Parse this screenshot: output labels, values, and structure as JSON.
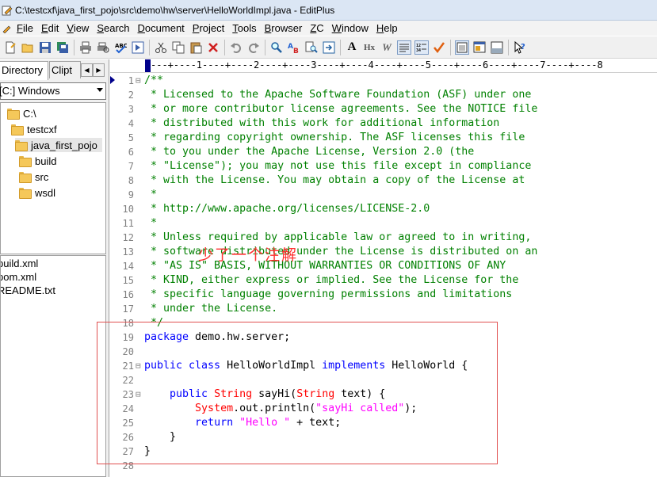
{
  "window": {
    "title": "C:\\testcxf\\java_first_pojo\\src\\demo\\hw\\server\\HelloWorldImpl.java - EditPlus"
  },
  "menu": [
    "File",
    "Edit",
    "View",
    "Search",
    "Document",
    "Project",
    "Tools",
    "Browser",
    "ZC",
    "Window",
    "Help"
  ],
  "toolbar": {
    "icons": [
      "new-icon",
      "open-icon",
      "save-icon",
      "save-all-icon",
      "print-icon",
      "print-preview-icon",
      "spellcheck-icon",
      "browser-preview-icon",
      "cut-icon",
      "copy-icon",
      "paste-icon",
      "delete-icon",
      "undo-icon",
      "redo-icon",
      "find-icon",
      "replace-icon",
      "find-in-files-icon",
      "goto-icon",
      "font-icon",
      "hex-icon",
      "word-wrap-icon",
      "ruler-icon",
      "line-number-icon",
      "check-icon",
      "window-icon",
      "full-screen-icon",
      "output-icon",
      "help-icon"
    ],
    "font_label": "A",
    "hex_label": "Hx",
    "wrap_label": "W"
  },
  "sidebar": {
    "tab_directory": "Directory",
    "tab_cliptext": "Clipt",
    "drive": "[C:] Windows",
    "tree": [
      "C:\\",
      "testcxf",
      "java_first_pojo",
      "build",
      "src",
      "wsdl"
    ],
    "files": [
      "build.xml",
      "pom.xml",
      "README.txt"
    ]
  },
  "ruler": "---+----1----+----2----+----3----+----4----+----5----+----6----+----7----+----8",
  "editor": {
    "line_numbers": [
      "1",
      "2",
      "3",
      "4",
      "5",
      "6",
      "7",
      "8",
      "9",
      "10",
      "11",
      "12",
      "13",
      "14",
      "15",
      "16",
      "17",
      "18",
      "19",
      "20",
      "21",
      "22",
      "23",
      "24",
      "25",
      "26",
      "27",
      "28"
    ],
    "lines": [
      [
        {
          "c": "cm",
          "t": "/**"
        }
      ],
      [
        {
          "c": "cm",
          "t": " * Licensed to the Apache Software Foundation (ASF) under one"
        }
      ],
      [
        {
          "c": "cm",
          "t": " * or more contributor license agreements. See the NOTICE file"
        }
      ],
      [
        {
          "c": "cm",
          "t": " * distributed with this work for additional information"
        }
      ],
      [
        {
          "c": "cm",
          "t": " * regarding copyright ownership. The ASF licenses this file"
        }
      ],
      [
        {
          "c": "cm",
          "t": " * to you under the Apache License, Version 2.0 (the"
        }
      ],
      [
        {
          "c": "cm",
          "t": " * \"License\"); you may not use this file except in compliance"
        }
      ],
      [
        {
          "c": "cm",
          "t": " * with the License. You may obtain a copy of the License at"
        }
      ],
      [
        {
          "c": "cm",
          "t": " *"
        }
      ],
      [
        {
          "c": "cm",
          "t": " * http://www.apache.org/licenses/LICENSE-2.0"
        }
      ],
      [
        {
          "c": "cm",
          "t": " *"
        }
      ],
      [
        {
          "c": "cm",
          "t": " * Unless required by applicable law or agreed to in writing,"
        }
      ],
      [
        {
          "c": "cm",
          "t": " * software distributed under the License is distributed on an"
        }
      ],
      [
        {
          "c": "cm",
          "t": " * \"AS IS\" BASIS, WITHOUT WARRANTIES OR CONDITIONS OF ANY"
        }
      ],
      [
        {
          "c": "cm",
          "t": " * KIND, either express or implied. See the License for the"
        }
      ],
      [
        {
          "c": "cm",
          "t": " * specific language governing permissions and limitations"
        }
      ],
      [
        {
          "c": "cm",
          "t": " * under the License."
        }
      ],
      [
        {
          "c": "cm",
          "t": " */"
        }
      ],
      [
        {
          "c": "kw",
          "t": "package"
        },
        {
          "c": "id",
          "t": " demo.hw.server;"
        }
      ],
      [],
      [
        {
          "c": "kw",
          "t": "public class"
        },
        {
          "c": "id",
          "t": " HelloWorldImpl "
        },
        {
          "c": "kw",
          "t": "implements"
        },
        {
          "c": "id",
          "t": " HelloWorld {"
        }
      ],
      [],
      [
        {
          "c": "id",
          "t": "    "
        },
        {
          "c": "kw",
          "t": "public"
        },
        {
          "c": "id",
          "t": " "
        },
        {
          "c": "ty",
          "t": "String"
        },
        {
          "c": "id",
          "t": " sayHi("
        },
        {
          "c": "ty",
          "t": "String"
        },
        {
          "c": "id",
          "t": " text) {"
        }
      ],
      [
        {
          "c": "id",
          "t": "        "
        },
        {
          "c": "ty",
          "t": "System"
        },
        {
          "c": "id",
          "t": ".out.println("
        },
        {
          "c": "st",
          "t": "\"sayHi called\""
        },
        {
          "c": "id",
          "t": ");"
        }
      ],
      [
        {
          "c": "id",
          "t": "        "
        },
        {
          "c": "kw",
          "t": "return"
        },
        {
          "c": "id",
          "t": " "
        },
        {
          "c": "st",
          "t": "\"Hello \""
        },
        {
          "c": "id",
          "t": " + text;"
        }
      ],
      [
        {
          "c": "id",
          "t": "    }"
        }
      ],
      [
        {
          "c": "id",
          "t": "}"
        }
      ],
      []
    ],
    "fold_markers": {
      "1": "⊟",
      "21": "⊟",
      "23": "⊟"
    }
  },
  "annotation": {
    "text": "少了一个注解",
    "color": "#ff3030"
  },
  "colors": {
    "comment": "#008000",
    "keyword": "#0000ff",
    "type": "#ff0000",
    "string": "#ff00ff",
    "annotation_box": "#e05050"
  }
}
